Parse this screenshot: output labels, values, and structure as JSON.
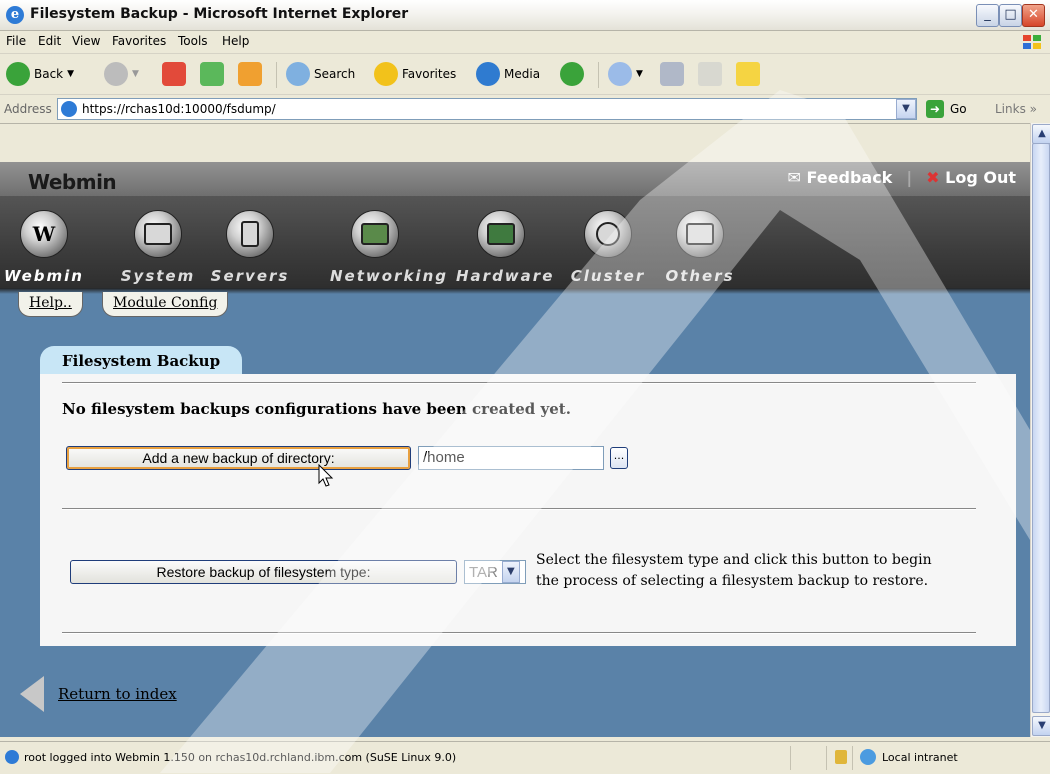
{
  "window": {
    "title": "Filesystem Backup - Microsoft Internet Explorer"
  },
  "menu": [
    "File",
    "Edit",
    "View",
    "Favorites",
    "Tools",
    "Help"
  ],
  "toolbar": {
    "back": "Back",
    "search": "Search",
    "favorites": "Favorites",
    "media": "Media"
  },
  "address": {
    "label": "Address",
    "url": "https://rchas10d:10000/fsdump/",
    "go": "Go",
    "links": "Links"
  },
  "webmin": {
    "logo": "Webmin",
    "feedback": "Feedback",
    "logout": "Log Out",
    "categories": [
      "Webmin",
      "System",
      "Servers",
      "Networking",
      "Hardware",
      "Cluster",
      "Others"
    ],
    "subtabs": {
      "help": "Help..",
      "module_config": "Module Config"
    }
  },
  "module": {
    "tab": "Filesystem Backup",
    "message": "No filesystem backups configurations have been created yet.",
    "add_button": "Add a new backup of directory:",
    "directory_value": "/home",
    "browse_button": "...",
    "restore_button": "Restore backup of filesystem type:",
    "fs_type": "TAR",
    "help_line1": "Select the filesystem type and click this button to begin",
    "help_line2": "the process of selecting a filesystem backup to restore.",
    "return_link": "Return to index"
  },
  "status": {
    "text": "root logged into Webmin 1.150 on rchas10d.rchland.ibm.com (SuSE Linux 9.0)",
    "zone": "Local intranet"
  }
}
